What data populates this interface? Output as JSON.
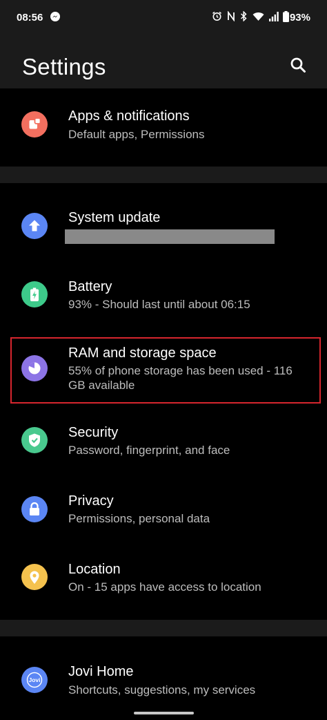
{
  "status_bar": {
    "time": "08:56",
    "battery_percent": "93%",
    "battery_level": 0.93,
    "icons": [
      "messenger-icon",
      "alarm-icon",
      "nfc-icon",
      "bluetooth-icon",
      "wifi-icon",
      "signal-icon",
      "battery-icon"
    ]
  },
  "header": {
    "title": "Settings",
    "search_icon": "search-icon"
  },
  "items": [
    {
      "id": "apps",
      "title": "Apps & notifications",
      "subtitle": "Default apps, Permissions",
      "icon": "apps-icon",
      "color": "#f36f5f"
    },
    {
      "id": "system-update",
      "title": "System update",
      "subtitle": "",
      "icon": "upload-arrow-icon",
      "color": "#5b86f4"
    },
    {
      "id": "battery",
      "title": "Battery",
      "subtitle": "93% - Should last until about 06:15",
      "icon": "battery-charge-icon",
      "color": "#3dca8a"
    },
    {
      "id": "ram-storage",
      "title": "RAM and storage space",
      "subtitle": "55% of phone storage has been used - 116 GB available",
      "icon": "pie-chart-icon",
      "color": "#8c74e6"
    },
    {
      "id": "security",
      "title": "Security",
      "subtitle": "Password, fingerprint, and face",
      "icon": "shield-check-icon",
      "color": "#49c98e"
    },
    {
      "id": "privacy",
      "title": "Privacy",
      "subtitle": "Permissions, personal data",
      "icon": "lock-icon",
      "color": "#5b86f4"
    },
    {
      "id": "location",
      "title": "Location",
      "subtitle": "On - 15 apps have access to location",
      "icon": "location-pin-icon",
      "color": "#f5c24e"
    },
    {
      "id": "jovi-home",
      "title": "Jovi Home",
      "subtitle": "Shortcuts, suggestions, my services",
      "icon": "jovi-icon",
      "color": "#5b86f4",
      "icon_text": "Jovi"
    }
  ],
  "colors": {
    "background": "#000000",
    "header_background": "#1b1b1b",
    "highlight": "#d7262e",
    "subtitle_text": "#bdbdbd"
  }
}
